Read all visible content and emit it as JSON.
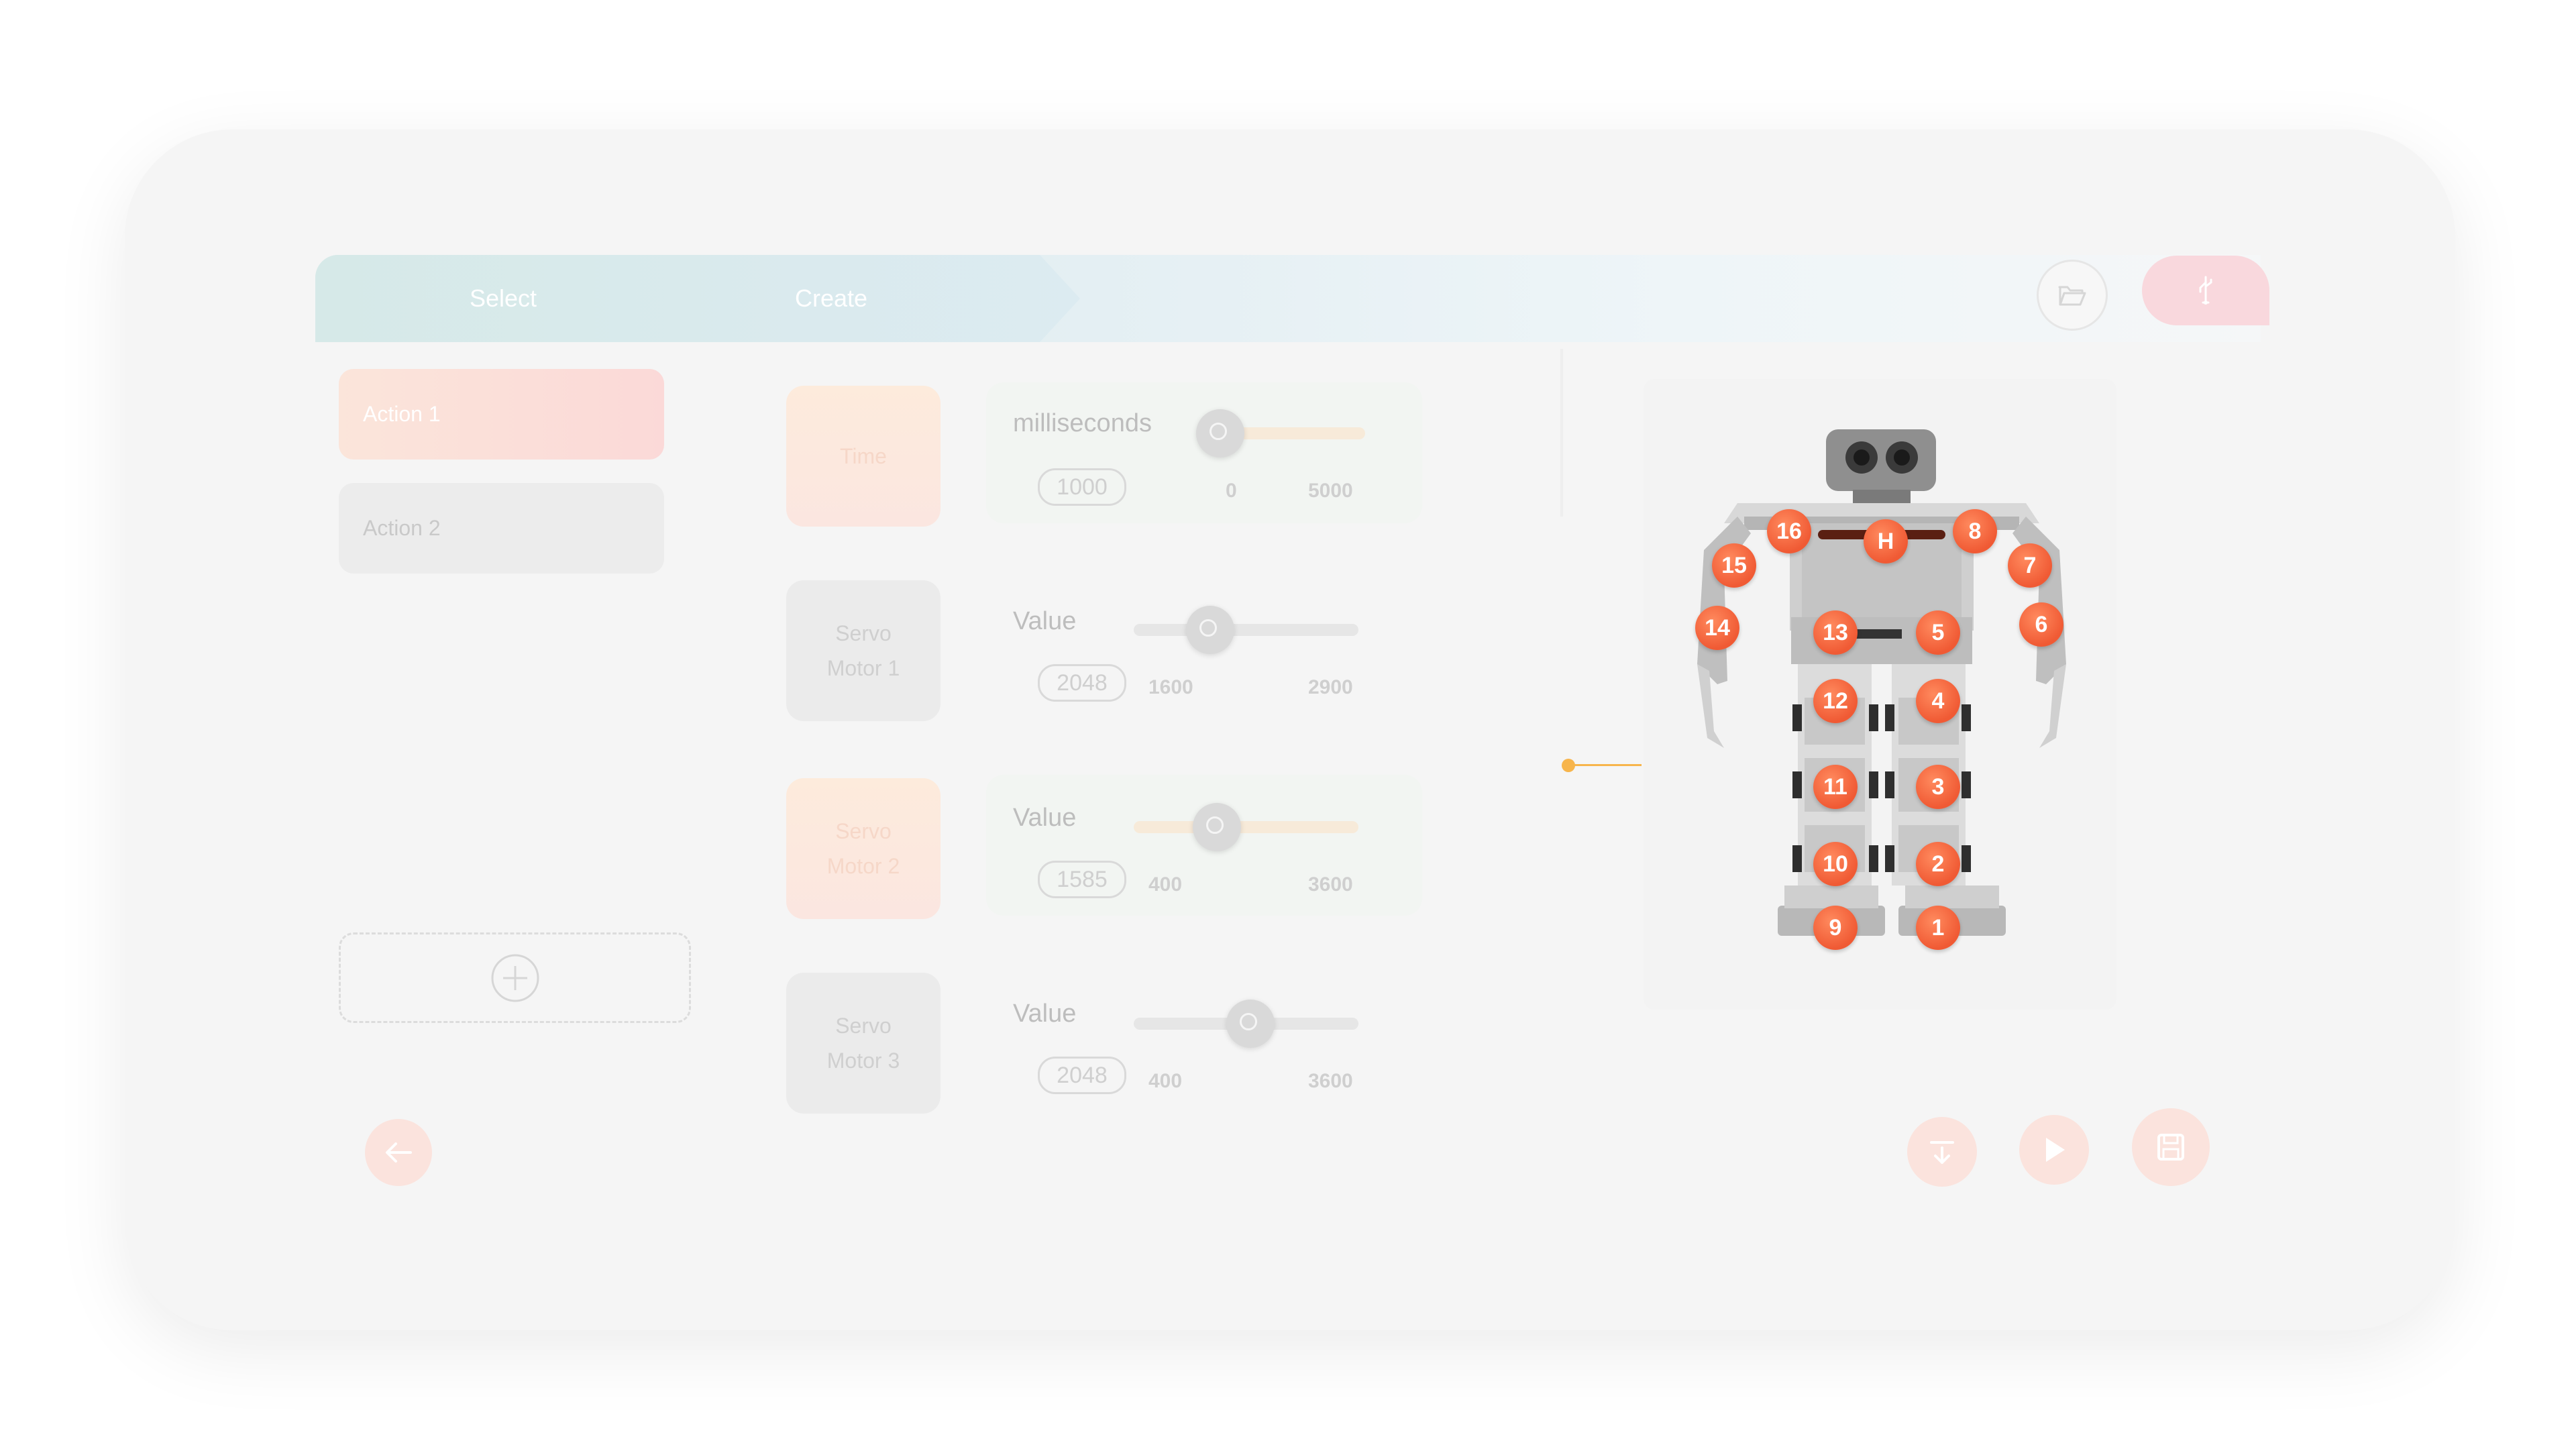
{
  "header": {
    "tabs": [
      {
        "label": "Select"
      },
      {
        "label": "Create"
      }
    ],
    "open_folder_icon": "folder-open-icon",
    "usb_icon": "usb-icon"
  },
  "actions": {
    "items": [
      {
        "label": "Action 1"
      },
      {
        "label": "Action 2"
      }
    ],
    "add_icon": "plus-circle-icon"
  },
  "rows": [
    {
      "card_label": "Time",
      "title": "milliseconds",
      "value": "1000",
      "min": "0",
      "max": "5000",
      "level": 0.08
    },
    {
      "card_label": "Servo\nMotor 1",
      "title": "Value",
      "value": "2048",
      "min": "1600",
      "max": "2900",
      "level": 0.34
    },
    {
      "card_label": "Servo\nMotor 2",
      "title": "Value",
      "value": "1585",
      "min": "400",
      "max": "3600",
      "level": 0.37
    },
    {
      "card_label": "Servo\nMotor 3",
      "title": "Value",
      "value": "2048",
      "min": "400",
      "max": "3600",
      "level": 0.52
    }
  ],
  "robot": {
    "joints": [
      "H",
      "1",
      "2",
      "3",
      "4",
      "5",
      "6",
      "7",
      "8",
      "9",
      "10",
      "11",
      "12",
      "13",
      "14",
      "15",
      "16"
    ]
  },
  "footer": {
    "back_icon": "arrow-left-icon",
    "download_icon": "download-icon",
    "play_icon": "play-icon",
    "save_icon": "save-icon"
  },
  "colors": {
    "accent": "#f05a34",
    "connector": "#f7b54c",
    "pink": "#f9d8dd"
  }
}
